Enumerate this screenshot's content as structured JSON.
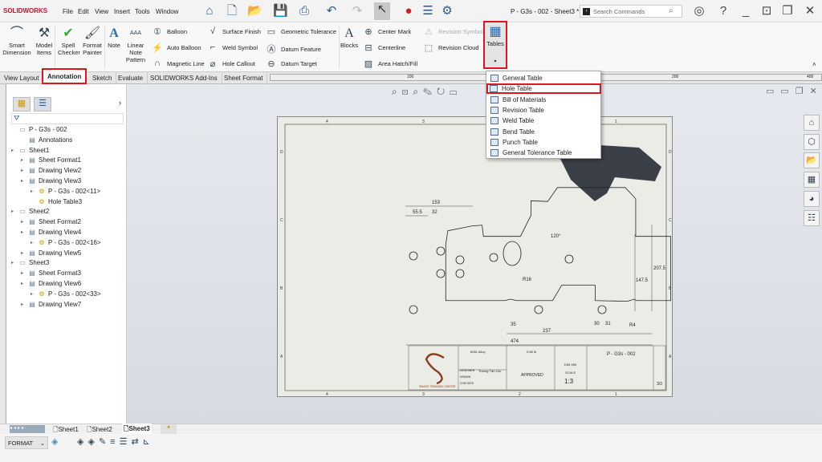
{
  "app": {
    "logo": "SOLIDWORKS",
    "title": "P - G3s - 002 - Sheet3 *",
    "search_placeholder": "Search Commands"
  },
  "menu": [
    "File",
    "Edit",
    "View",
    "Insert",
    "Tools",
    "Window"
  ],
  "ribbon": {
    "big": [
      {
        "label": "Smart Dimension"
      },
      {
        "label": "Model Items"
      },
      {
        "label": "Spell Checker"
      },
      {
        "label": "Format Painter"
      },
      {
        "label": "Note"
      },
      {
        "label": "Linear Note Pattern"
      }
    ],
    "col1": [
      "Balloon",
      "Auto Balloon",
      "Magnetic Line"
    ],
    "col2": [
      "Surface Finish",
      "Weld Symbol",
      "Hole Callout"
    ],
    "col3": [
      "Geometric Tolerance",
      "Datum Feature",
      "Datum Target"
    ],
    "blocks": "Blocks",
    "col4": [
      "Center Mark",
      "Centerline",
      "Area Hatch/Fill"
    ],
    "col5": [
      "Revision Symbol",
      "Revision Cloud"
    ],
    "tables": "Tables"
  },
  "tabs": [
    "View Layout",
    "Annotation",
    "Sketch",
    "Evaluate",
    "SOLIDWORKS Add-Ins",
    "Sheet Format"
  ],
  "active_tab": "Annotation",
  "ruler": [
    "100",
    "200",
    "400"
  ],
  "tables_menu": [
    "General Table",
    "Hole Table",
    "Bill of Materials",
    "Revision Table",
    "Weld Table",
    "Bend Table",
    "Punch Table",
    "General Tolerance Table"
  ],
  "highlighted_menu_item": "Hole Table",
  "tree": [
    {
      "label": "P - G3s - 002",
      "level": 0
    },
    {
      "label": "Annotations",
      "level": 1
    },
    {
      "label": "Sheet1",
      "level": 0
    },
    {
      "label": "Sheet Format1",
      "level": 1
    },
    {
      "label": "Drawing View2",
      "level": 1
    },
    {
      "label": "Drawing View3",
      "level": 1
    },
    {
      "label": "P - G3s - 002<11>",
      "level": 2
    },
    {
      "label": "Hole Table3",
      "level": 2
    },
    {
      "label": "Sheet2",
      "level": 0
    },
    {
      "label": "Sheet Format2",
      "level": 1
    },
    {
      "label": "Drawing View4",
      "level": 1
    },
    {
      "label": "P - G3s - 002<16>",
      "level": 2
    },
    {
      "label": "Drawing View5",
      "level": 1
    },
    {
      "label": "Sheet3",
      "level": 0
    },
    {
      "label": "Sheet Format3",
      "level": 1
    },
    {
      "label": "Drawing View6",
      "level": 1
    },
    {
      "label": "P - G3s - 002<33>",
      "level": 2
    },
    {
      "label": "Drawing View7",
      "level": 1
    }
  ],
  "drawing": {
    "dims": [
      "153",
      "55.5",
      "32",
      "120°",
      "R16",
      "147.5",
      "207.5",
      "35",
      "237",
      "30",
      "31",
      "R4",
      "474"
    ],
    "border_cols": [
      "4",
      "3",
      "2",
      "1"
    ],
    "border_rows": [
      "A",
      "B",
      "C",
      "D"
    ]
  },
  "title_block": {
    "material": "6061 Alloy",
    "weight": "0.68 lb",
    "designer": "Truong Tấn Lộc",
    "approved": "APPROVED",
    "unit": "DIM  MM",
    "scale_label": "SCALE",
    "scale": "1:3",
    "drawing_no": "P - G3s - 002",
    "sheet": "3/3",
    "company": "SMACE TRAINING CENTER",
    "row_labels": [
      "DESIGNER",
      "DRAWN",
      "CHECKED"
    ]
  },
  "sheet_tabs": [
    "Sheet1",
    "Sheet2",
    "Sheet3"
  ],
  "active_sheet": "Sheet3",
  "format_select": "FORMAT",
  "colors": {
    "highlight": "#e0141e",
    "accent": "#1f5fa8"
  }
}
